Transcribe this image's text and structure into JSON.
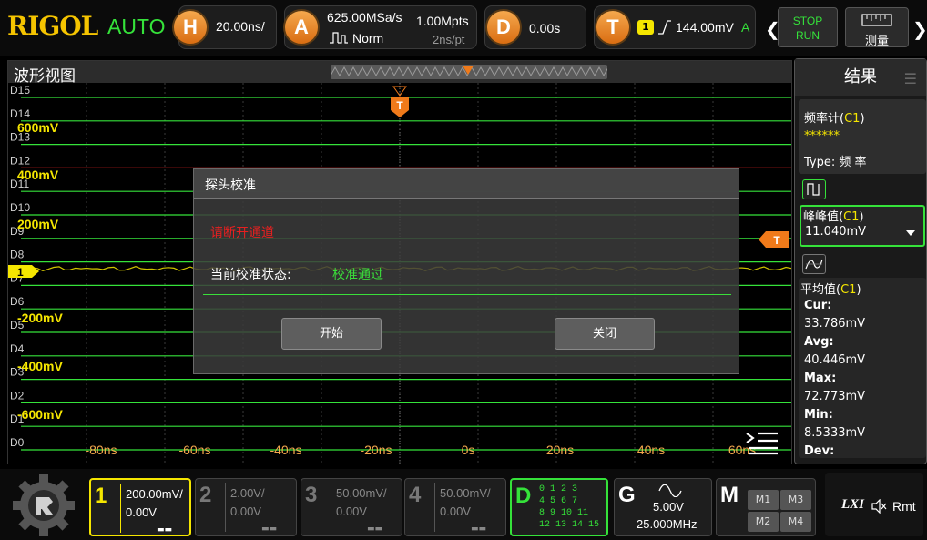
{
  "brand": {
    "logo": "RIGOL",
    "trigger_mode": "AUTO"
  },
  "horizontal": {
    "key": "H",
    "timebase": "20.00ns/"
  },
  "acquire": {
    "key": "A",
    "sample_rate": "625.00MSa/s",
    "memory_depth": "1.00Mpts",
    "mode": "Norm",
    "sample_interval": "2ns/pt"
  },
  "delay": {
    "key": "D",
    "value": "0.00s"
  },
  "trigger": {
    "key": "T",
    "channel": "1",
    "level": "144.00mV",
    "mode_letter": "A"
  },
  "run_control": {
    "stop": "STOP",
    "run": "RUN"
  },
  "measure_button": {
    "label": "测量"
  },
  "waveform": {
    "title": "波形视图",
    "digital_labels": [
      "D15",
      "D14",
      "D13",
      "D12",
      "D11",
      "D10",
      "D9",
      "D8",
      "D7",
      "D6",
      "D5",
      "D4",
      "D3",
      "D2",
      "D1",
      "D0"
    ],
    "voltage_labels": [
      "600mV",
      "400mV",
      "200mV",
      "-200mV",
      "-400mV",
      "-600mV"
    ],
    "time_labels": [
      "-80ns",
      "-60ns",
      "-40ns",
      "-20ns",
      "0s",
      "20ns",
      "40ns",
      "60ns"
    ],
    "ch1_marker": "1",
    "trigger_marker": "T"
  },
  "dialog": {
    "title": "探头校准",
    "warning": "请断开通道",
    "status_label": "当前校准状态:",
    "status_value": "校准通过",
    "start_button": "开始",
    "close_button": "关闭"
  },
  "results": {
    "title": "结果",
    "counter": {
      "label": "频率计(",
      "channel": "C1",
      "close": ")",
      "value": "******",
      "type_label": "Type:  频 率"
    },
    "vpp": {
      "label": "峰峰值(",
      "channel": "C1",
      "close": ")",
      "value": "11.040mV"
    },
    "vavg": {
      "label": "平均值(",
      "channel": "C1",
      "close": ")",
      "cur_label": "Cur:",
      "cur": "33.786mV",
      "avg_label": "Avg:",
      "avg": "40.446mV",
      "max_label": "Max:",
      "max": "72.773mV",
      "min_label": "Min:",
      "min": "8.5333mV",
      "dev_label": "Dev:"
    }
  },
  "channels": [
    {
      "num": "1",
      "scale": "200.00mV/",
      "offset": "0.00V",
      "active": true
    },
    {
      "num": "2",
      "scale": "2.00V/",
      "offset": "0.00V",
      "active": false
    },
    {
      "num": "3",
      "scale": "50.00mV/",
      "offset": "0.00V",
      "active": false
    },
    {
      "num": "4",
      "scale": "50.00mV/",
      "offset": "0.00V",
      "active": false
    }
  ],
  "digital": {
    "letter": "D",
    "rows": [
      "0   1   2   3",
      "4   5   6   7",
      "8   9   10  11",
      "12  13  14  15"
    ]
  },
  "generator": {
    "letter": "G",
    "amplitude": "5.00V",
    "frequency": "25.000MHz"
  },
  "math": {
    "letter": "M",
    "items": [
      "M1",
      "M3",
      "M2",
      "M4"
    ]
  },
  "status": {
    "lxi": "LXI",
    "remote": "Rmt"
  },
  "colors": {
    "ch1": "#f5e600",
    "digital": "#35e23a",
    "trigger": "#f07a1a",
    "accent_orange": "#f5a84d",
    "alert": "#e62020"
  }
}
